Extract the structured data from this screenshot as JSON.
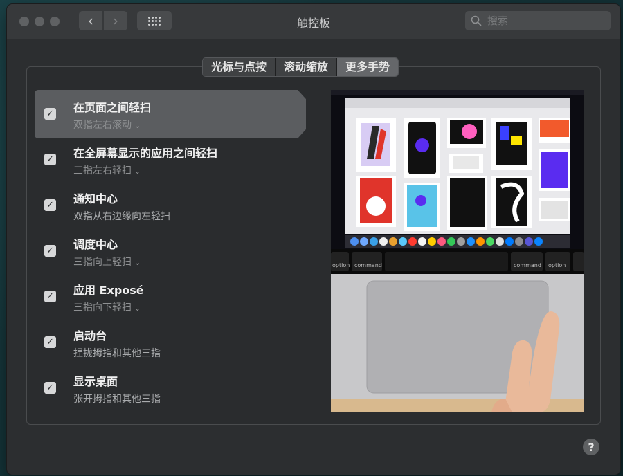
{
  "window": {
    "title": "触控板",
    "search_placeholder": "搜索"
  },
  "tabs": [
    {
      "label": "光标与点按",
      "active": false
    },
    {
      "label": "滚动缩放",
      "active": false
    },
    {
      "label": "更多手势",
      "active": true
    }
  ],
  "gestures": [
    {
      "title": "在页面之间轻扫",
      "subtitle": "双指左右滚动",
      "has_dropdown": true,
      "checked": true,
      "selected": true
    },
    {
      "title": "在全屏幕显示的应用之间轻扫",
      "subtitle": "三指左右轻扫",
      "has_dropdown": true,
      "checked": true,
      "selected": false
    },
    {
      "title": "通知中心",
      "subtitle": "双指从右边缘向左轻扫",
      "has_dropdown": false,
      "checked": true,
      "selected": false
    },
    {
      "title": "调度中心",
      "subtitle": "三指向上轻扫",
      "has_dropdown": true,
      "checked": true,
      "selected": false
    },
    {
      "title": "应用 Exposé",
      "subtitle": "三指向下轻扫",
      "has_dropdown": true,
      "checked": true,
      "selected": false
    },
    {
      "title": "启动台",
      "subtitle": "捏拢拇指和其他三指",
      "has_dropdown": false,
      "checked": true,
      "selected": false
    },
    {
      "title": "显示桌面",
      "subtitle": "张开拇指和其他三指",
      "has_dropdown": false,
      "checked": true,
      "selected": false
    }
  ],
  "preview": {
    "touchbar_left": [
      "option",
      "command"
    ],
    "touchbar_right": [
      "command",
      "option"
    ]
  },
  "help_label": "?",
  "check_glyph": "✓"
}
